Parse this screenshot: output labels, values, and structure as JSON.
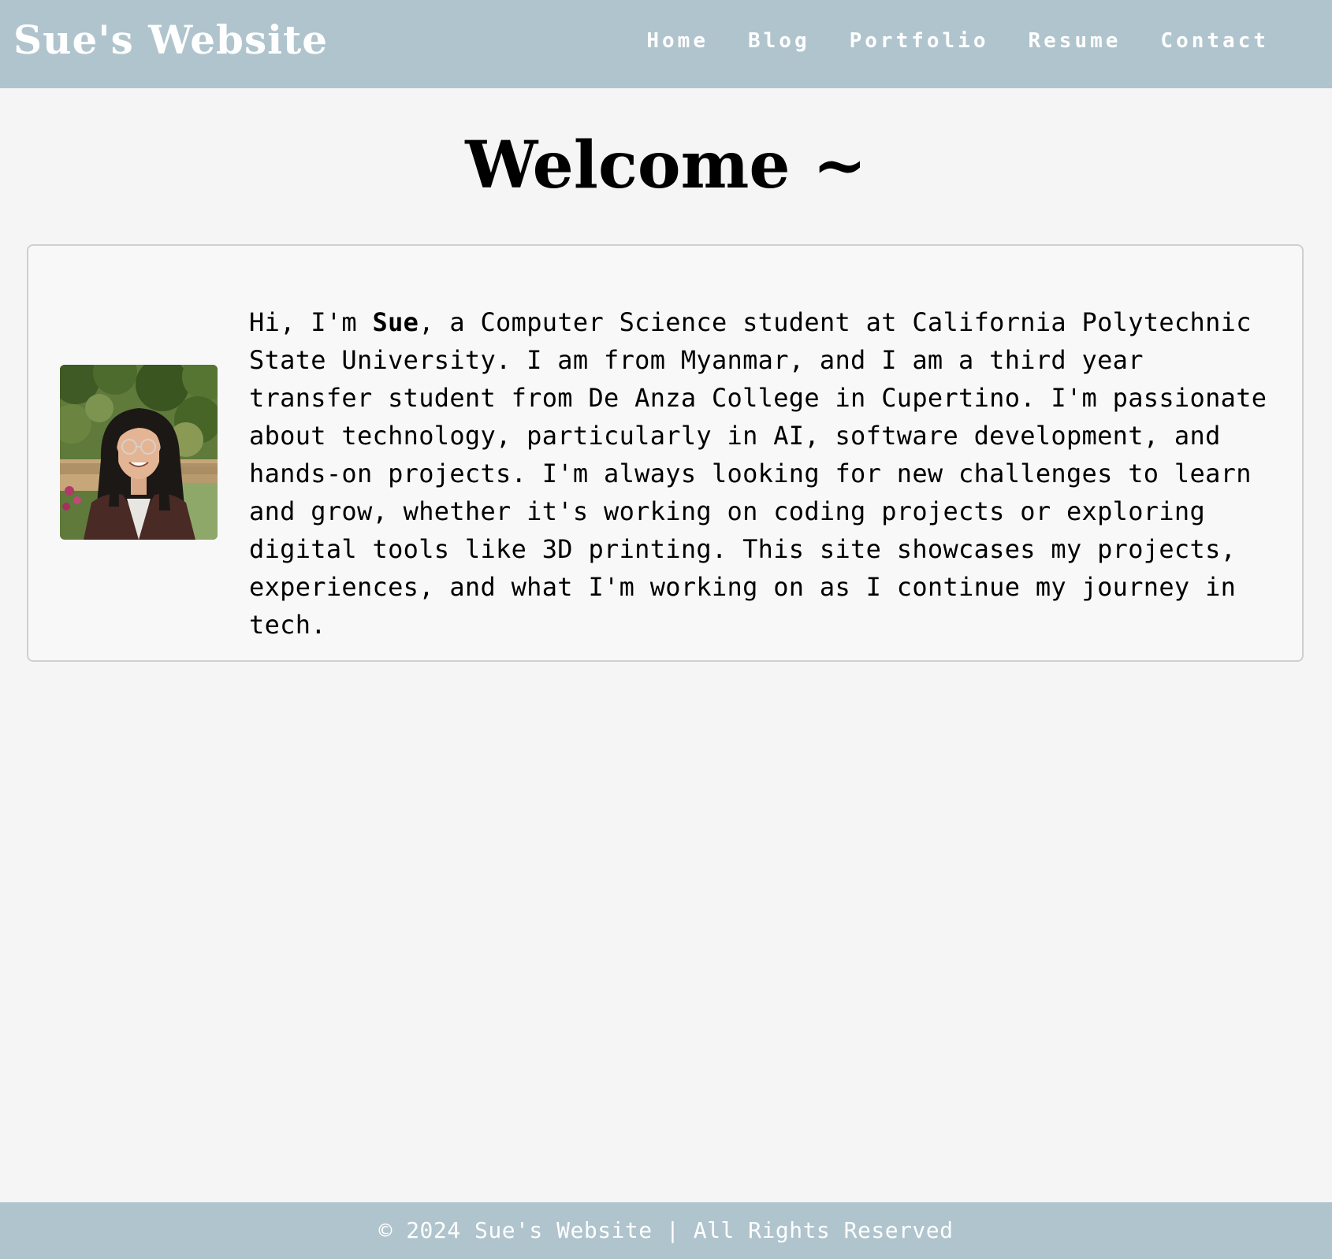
{
  "header": {
    "title": "Sue's Website",
    "nav": [
      {
        "label": "Home"
      },
      {
        "label": "Blog"
      },
      {
        "label": "Portfolio"
      },
      {
        "label": "Resume"
      },
      {
        "label": "Contact"
      }
    ]
  },
  "main": {
    "heading": "Welcome ~",
    "intro": {
      "photo_icon": "profile-photo",
      "text_before": "Hi, I'm ",
      "name": "Sue",
      "text_after": ", a Computer Science student at California Polytechnic State University. I am from Myanmar, and I am a third year transfer student from De Anza College in Cupertino. I'm passionate about technology, particularly in AI, software development, and hands-on projects. I'm always looking for new challenges to learn and grow, whether it's working on coding projects or exploring digital tools like 3D printing. This site showcases my projects, experiences, and what I'm working on as I continue my journey in tech."
    }
  },
  "footer": {
    "text": "© 2024 Sue's Website | All Rights Reserved"
  },
  "colors": {
    "header_bg": "#b0c4cd",
    "page_bg": "#f5f5f5",
    "card_bg": "#f8f8f8",
    "card_border": "#cfcfcf",
    "header_text": "#ffffff"
  }
}
